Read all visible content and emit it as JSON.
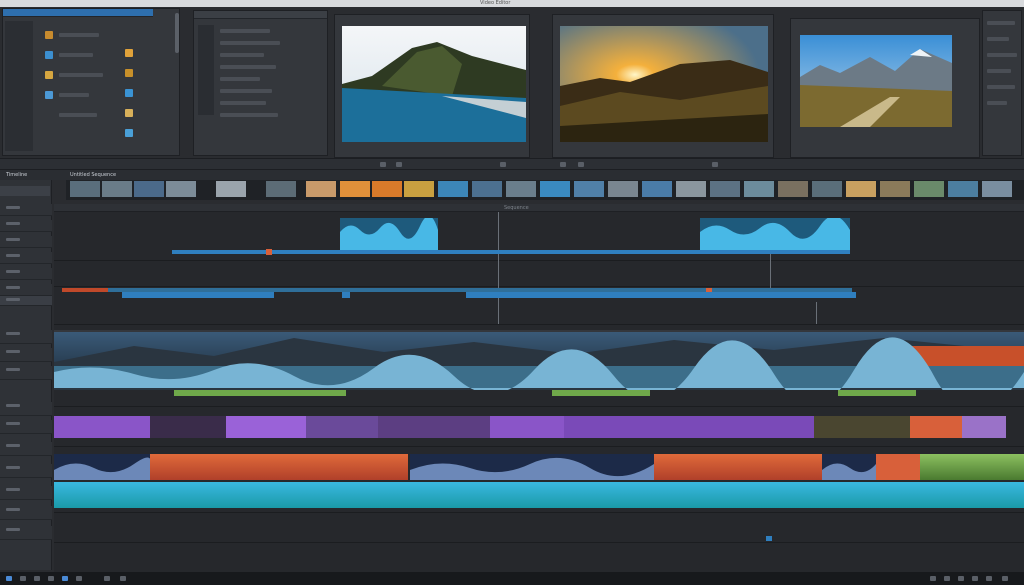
{
  "app": {
    "window_title": "Video Editor"
  },
  "timeline": {
    "panel_title": "Timeline",
    "sequence_name": "Untitled Sequence",
    "ruler_label": "Sequence"
  },
  "colors": {
    "accent_blue": "#2f7fbf",
    "audio_waveform": "#3aa6d8",
    "clip_purple": "#8a55c8",
    "clip_orange": "#d8603a",
    "clip_green": "#6fa84a",
    "clip_teal": "#1aa6b8"
  }
}
